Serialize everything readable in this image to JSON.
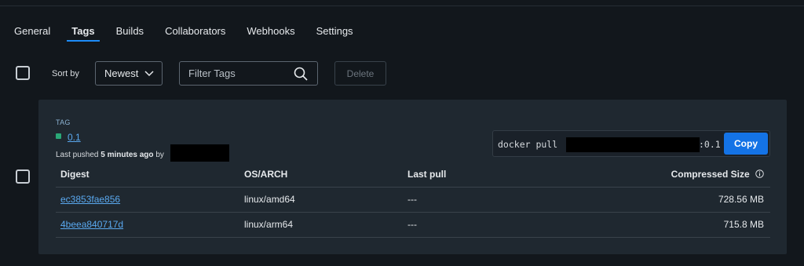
{
  "tabs": [
    {
      "label": "General",
      "active": false
    },
    {
      "label": "Tags",
      "active": true
    },
    {
      "label": "Builds",
      "active": false
    },
    {
      "label": "Collaborators",
      "active": false
    },
    {
      "label": "Webhooks",
      "active": false
    },
    {
      "label": "Settings",
      "active": false
    }
  ],
  "toolbar": {
    "sort_label": "Sort by",
    "sort_value": "Newest",
    "filter_placeholder": "Filter Tags",
    "delete_label": "Delete"
  },
  "tag_card": {
    "tag_heading": "TAG",
    "tag_name": "0.1",
    "pushed_prefix": "Last pushed",
    "pushed_time": "5 minutes ago",
    "pushed_by": "by",
    "pull_command_prefix": "docker pull",
    "pull_command_suffix": ":0.1",
    "copy_label": "Copy",
    "columns": [
      "Digest",
      "OS/ARCH",
      "Last pull",
      "Compressed Size"
    ],
    "rows": [
      {
        "digest": "ec3853fae856",
        "os_arch": "linux/amd64",
        "last_pull": "---",
        "size": "728.56 MB"
      },
      {
        "digest": "4beea840717d",
        "os_arch": "linux/arm64",
        "last_pull": "---",
        "size": "715.8 MB"
      }
    ]
  },
  "icons": {
    "sort": "chevron-down-icon",
    "filter": "search-icon",
    "size_info": "info-icon",
    "tag_status": "green-square-status"
  },
  "colors": {
    "accent": "#1d8cf8",
    "link": "#5aa9f0",
    "copy_button": "#1473e6",
    "tag_status": "#2aa877",
    "background": "#12171c",
    "card": "#1f2830"
  }
}
